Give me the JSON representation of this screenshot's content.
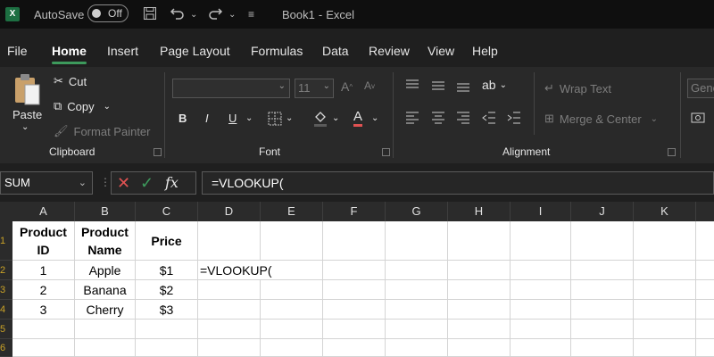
{
  "titlebar": {
    "logo": "X",
    "autosave_label": "AutoSave",
    "autosave_toggle": "Off",
    "save_icon": "save-icon",
    "title": "Book1",
    "separator": "-",
    "app_name": "Excel"
  },
  "menu": [
    "File",
    "Home",
    "Insert",
    "Page Layout",
    "Formulas",
    "Data",
    "Review",
    "View",
    "Help"
  ],
  "ribbon": {
    "clipboard": {
      "paste": "Paste",
      "cut": "Cut",
      "copy": "Copy",
      "format_painter": "Format Painter",
      "label": "Clipboard"
    },
    "font": {
      "size": "11",
      "bold": "B",
      "italic": "I",
      "underline": "U",
      "font_color": "A",
      "label": "Font"
    },
    "alignment": {
      "wrap": "Wrap Text",
      "merge": "Merge & Center",
      "label": "Alignment"
    },
    "number": {
      "format": "Gene"
    }
  },
  "formula_bar": {
    "name_box": "SUM",
    "fx": "fx",
    "formula": "=VLOOKUP("
  },
  "grid": {
    "columns": [
      "A",
      "B",
      "C",
      "D",
      "E",
      "F",
      "G",
      "H",
      "I",
      "J",
      "K"
    ],
    "row_numbers": [
      "1",
      "2",
      "3",
      "4",
      "5",
      "6"
    ],
    "headers": {
      "a1": "Product ID",
      "b1": "Product Name",
      "c1": "Price"
    },
    "rows": [
      {
        "a": "1",
        "b": "Apple",
        "c": "$1",
        "d": "=VLOOKUP("
      },
      {
        "a": "2",
        "b": "Banana",
        "c": "$2",
        "d": ""
      },
      {
        "a": "3",
        "b": "Cherry",
        "c": "$3",
        "d": ""
      }
    ]
  },
  "colors": {
    "accent": "#3d9a5c",
    "excel_green": "#1d6f42",
    "cancel_red": "#e05252",
    "enter_green": "#3d9a5c"
  }
}
